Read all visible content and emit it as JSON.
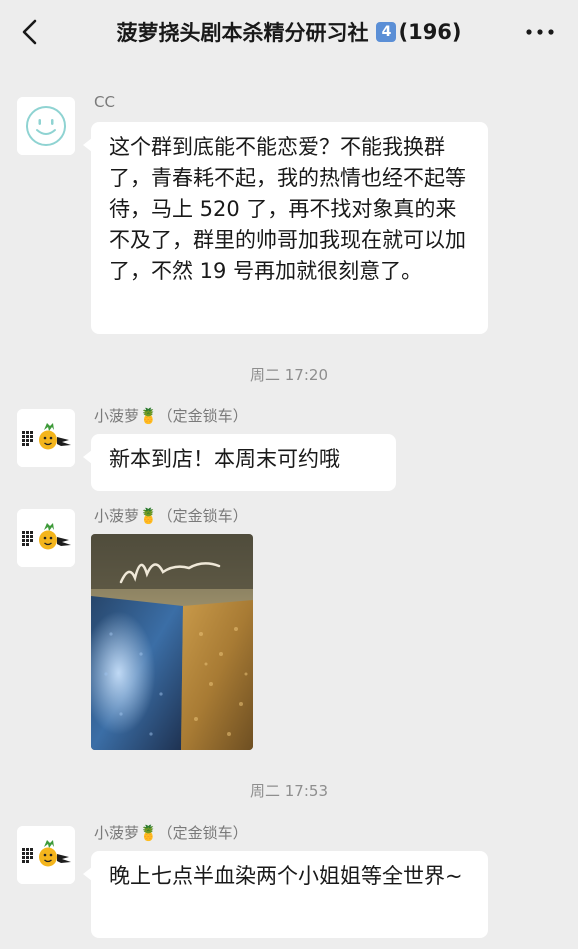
{
  "header": {
    "title": "菠萝挠头剧本杀精分研习社",
    "badge": "4",
    "member_count": "(196)"
  },
  "messages": [
    {
      "sender": "CC",
      "text": "这个群到底能不能恋爱？不能我换群了，青春耗不起，我的热情也经不起等待，马上 520 了，再不找对象真的来不及了，群里的帅哥加我现在就可以加了，不然 19 号再加就很刻意了。"
    },
    {
      "time": "周二 17:20"
    },
    {
      "sender": "小菠萝🍍（定金锁车）",
      "text": "新本到店！本周末可约哦"
    },
    {
      "sender": "小菠萝🍍（定金锁车）",
      "image": "script-box-photo"
    },
    {
      "time": "周二 17:53"
    },
    {
      "sender": "小菠萝🍍（定金锁车）",
      "text": "晚上七点半血染两个小姐姐等全世界~"
    }
  ],
  "colors": {
    "background": "#ededed",
    "bubble": "#ffffff",
    "badge": "#5b8fd6",
    "meta_text": "#8e8e8e"
  },
  "icons": {
    "back": "chevron-left-icon",
    "more": "ellipsis-icon",
    "cc_avatar": "smiley-avatar",
    "shop_avatar": "pineapple-logo-avatar"
  }
}
